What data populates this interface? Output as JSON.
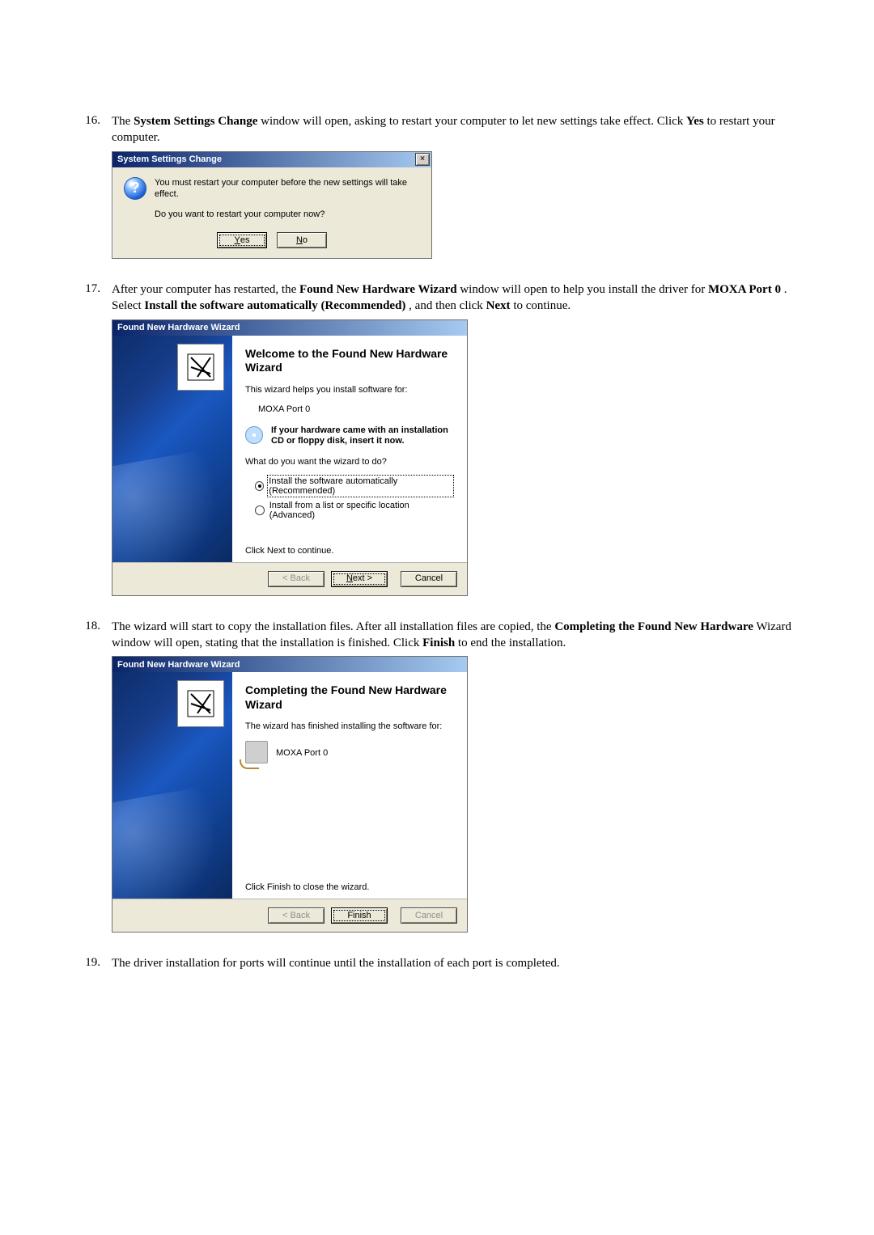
{
  "step16": {
    "num": "16.",
    "text_before_bold1": "The ",
    "bold1": "System Settings Change",
    "text_mid1": " window will open, asking to restart your computer to let new settings take effect. Click ",
    "bold2": "Yes",
    "text_after": " to restart your computer.",
    "dialog": {
      "title": "System Settings Change",
      "close": "×",
      "line1": "You must restart your computer before the new settings will take effect.",
      "line2": "Do you want to restart your computer now?",
      "yes_u": "Y",
      "yes_rest": "es",
      "no_u": "N",
      "no_rest": "o"
    }
  },
  "step17": {
    "num": "17.",
    "p_t1": "After your computer has restarted, the ",
    "p_b1": "Found New Hardware Wizard",
    "p_t2": " window will open to help you install the driver for ",
    "p_b2": "MOXA Port 0",
    "p_t3": ". Select ",
    "p_b3": "Install the software automatically (Recommended)",
    "p_t4": ", and then click ",
    "p_b4": "Next",
    "p_t5": " to continue.",
    "dialog": {
      "title": "Found New Hardware Wizard",
      "heading": "Welcome to the Found New Hardware Wizard",
      "helps": "This wizard helps you install software for:",
      "device": "MOXA Port 0",
      "cd_line": "If your hardware came with an installation CD or floppy disk, insert it now.",
      "what": "What do you want the wizard to do?",
      "opt1": "Install the software automatically (Recommended)",
      "opt2": "Install from a list or specific location (Advanced)",
      "next_hint": "Click Next to continue.",
      "back": "< Back",
      "next_u": "N",
      "next_rest": "ext >",
      "cancel": "Cancel"
    }
  },
  "step18": {
    "num": "18.",
    "p_t1": "The wizard will start to copy the installation files. After all installation files are copied, the ",
    "p_b1": "Completing the Found New Hardware",
    "p_t2": " Wizard window will open, stating that the installation is finished. Click ",
    "p_b2": "Finish",
    "p_t3": " to end the installation.",
    "dialog": {
      "title": "Found New Hardware Wizard",
      "heading": "Completing the Found New Hardware Wizard",
      "done": "The wizard has finished installing the software for:",
      "device": "MOXA Port 0",
      "close_hint": "Click Finish to close the wizard.",
      "back": "< Back",
      "finish": "Finish",
      "cancel": "Cancel"
    }
  },
  "step19": {
    "num": "19.",
    "text": "The driver installation for ports will continue until the installation of each port is completed."
  }
}
